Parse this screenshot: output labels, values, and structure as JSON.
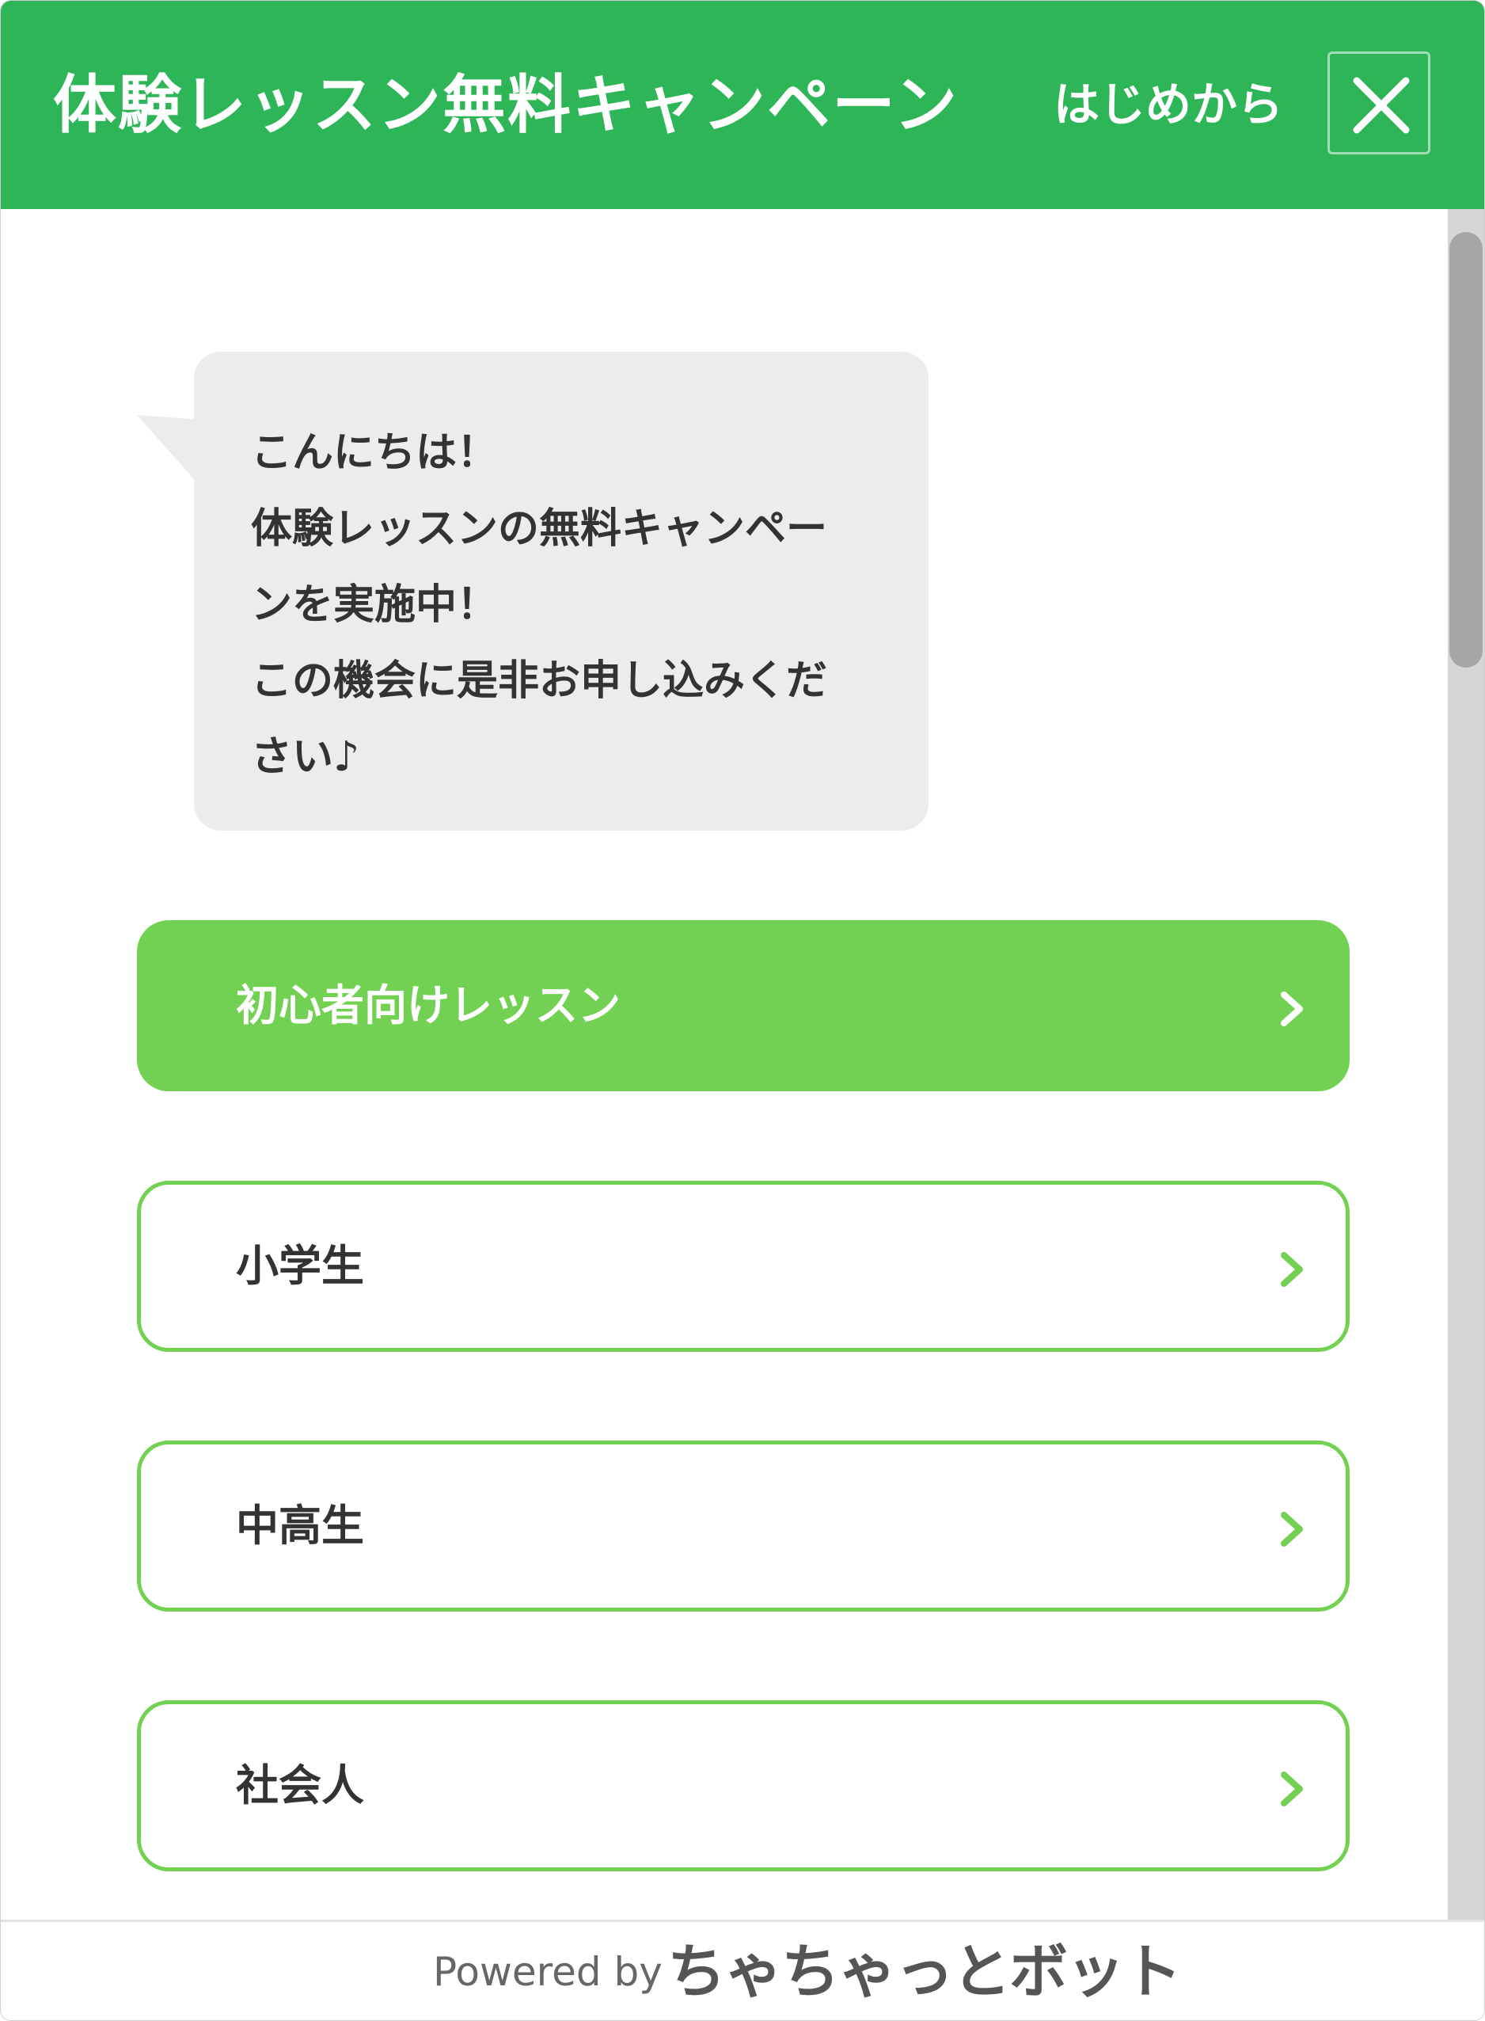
{
  "header": {
    "title": "体験レッスン無料キャンペーン",
    "restart_label": "はじめから",
    "close_icon": "close-icon"
  },
  "colors": {
    "header_bg": "#2db557",
    "accent": "#72d152",
    "bubble_bg": "#ececec",
    "text": "#333333"
  },
  "message": {
    "lines": [
      "こんにちは！",
      "体験レッスンの無料キャンペー",
      "ンを実施中！",
      "この機会に是非お申し込みくだ",
      "さい♪"
    ]
  },
  "choices": [
    {
      "label": "初心者向けレッスン",
      "style": "filled"
    },
    {
      "label": "小学生",
      "style": "outline"
    },
    {
      "label": "中高生",
      "style": "outline"
    },
    {
      "label": "社会人",
      "style": "outline"
    }
  ],
  "footer": {
    "powered_by": "Powered by",
    "brand": "ちゃちゃっとボット"
  }
}
